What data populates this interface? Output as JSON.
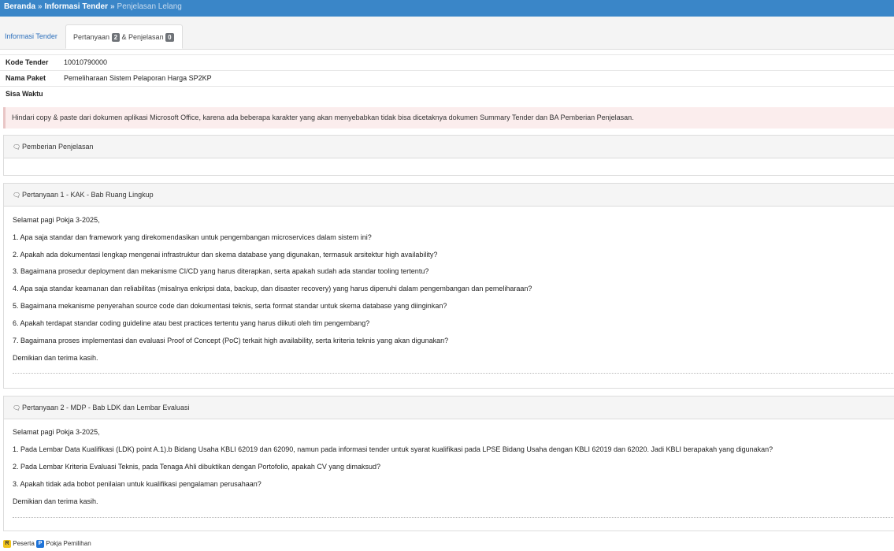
{
  "breadcrumb": {
    "home": "Beranda",
    "separator": "»",
    "info": "Informasi Tender",
    "current": "Penjelasan Lelang"
  },
  "tabs": {
    "info_label": "Informasi Tender",
    "qa_label_prefix": "Pertanyaan",
    "qa_count": "2",
    "qa_label_mid": "& Penjelasan",
    "explain_count": "0"
  },
  "details": [
    {
      "key": "Kode Tender",
      "value": "10010790000"
    },
    {
      "key": "Nama Paket",
      "value": "Pemeliharaan Sistem Pelaporan Harga SP2KP"
    },
    {
      "key": "Sisa Waktu",
      "value": ""
    }
  ],
  "alert": "Hindari copy & paste dari dokumen aplikasi Microsoft Office, karena ada beberapa karakter yang akan menyebabkan tidak bisa dicetaknya dokumen Summary Tender dan BA Pemberian Penjelasan.",
  "explanation_panel": {
    "title": "Pemberian Penjelasan"
  },
  "questions": [
    {
      "title": "Pertanyaan 1 - KAK - Bab Ruang Lingkup",
      "lines": [
        "Selamat pagi Pokja 3-2025,",
        "1. Apa saja standar dan framework yang direkomendasikan untuk pengembangan microservices dalam sistem ini?",
        "2. Apakah ada dokumentasi lengkap mengenai infrastruktur dan skema database yang digunakan, termasuk arsitektur high availability?",
        "3. Bagaimana prosedur deployment dan mekanisme CI/CD yang harus diterapkan, serta apakah sudah ada standar tooling tertentu?",
        "4. Apa saja standar keamanan dan reliabilitas (misalnya enkripsi data, backup, dan disaster recovery) yang harus dipenuhi dalam pengembangan dan pemeliharaan?",
        "5. Bagaimana mekanisme penyerahan source code dan dokumentasi teknis, serta format standar untuk skema database yang diinginkan?",
        "6. Apakah terdapat standar coding guideline atau best practices tertentu yang harus diikuti oleh tim pengembang?",
        "7. Bagaimana proses implementasi dan evaluasi Proof of Concept (PoC) terkait high availability, serta kriteria teknis yang akan digunakan?",
        "Demikian dan terima kasih."
      ]
    },
    {
      "title": "Pertanyaan 2 - MDP - Bab LDK dan Lembar Evaluasi",
      "lines": [
        "Selamat pagi Pokja 3-2025,",
        "1. Pada Lembar Data Kualifikasi (LDK) point A.1).b Bidang Usaha KBLI 62019 dan 62090, namun pada informasi tender untuk syarat kualifikasi pada LPSE Bidang Usaha dengan KBLI 62019 dan 62020. Jadi KBLI berapakah yang digunakan?",
        "2. Pada Lembar Kriteria Evaluasi Teknis, pada Tenaga Ahli dibuktikan dengan Portofolio, apakah CV yang dimaksud?",
        "3. Apakah tidak ada bobot penilaian untuk kualifikasi pengalaman perusahaan?",
        "Demikian dan terima kasih."
      ]
    }
  ],
  "legend": {
    "r_badge": "R",
    "r_label": "Peserta",
    "p_badge": "P",
    "p_label": "Pokja Pemilihan"
  }
}
